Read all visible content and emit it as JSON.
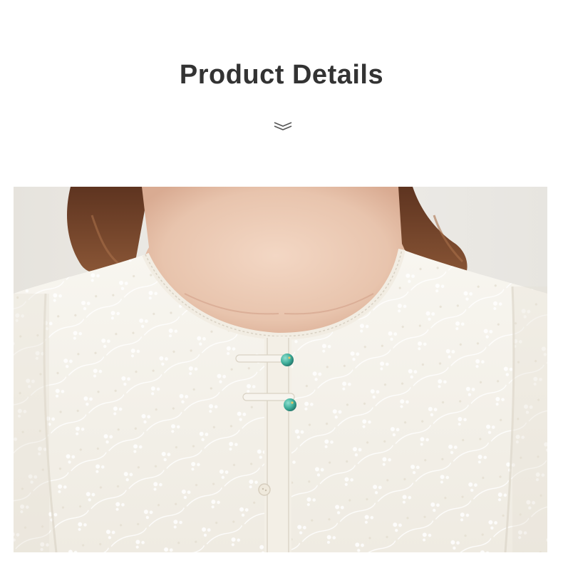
{
  "header": {
    "title": "Product Details",
    "divider_icon": "double-chevron-down-icon"
  },
  "photo": {
    "subject": "blouse-neckline",
    "colors": {
      "background": "#ecebe7",
      "hair": "#7a4a2c",
      "skin": "#e9c9b4",
      "fabric": "#f6f3ec",
      "embroidery": "#ffffff",
      "bead": "#3fae9a",
      "button": "#efe9dc"
    }
  }
}
